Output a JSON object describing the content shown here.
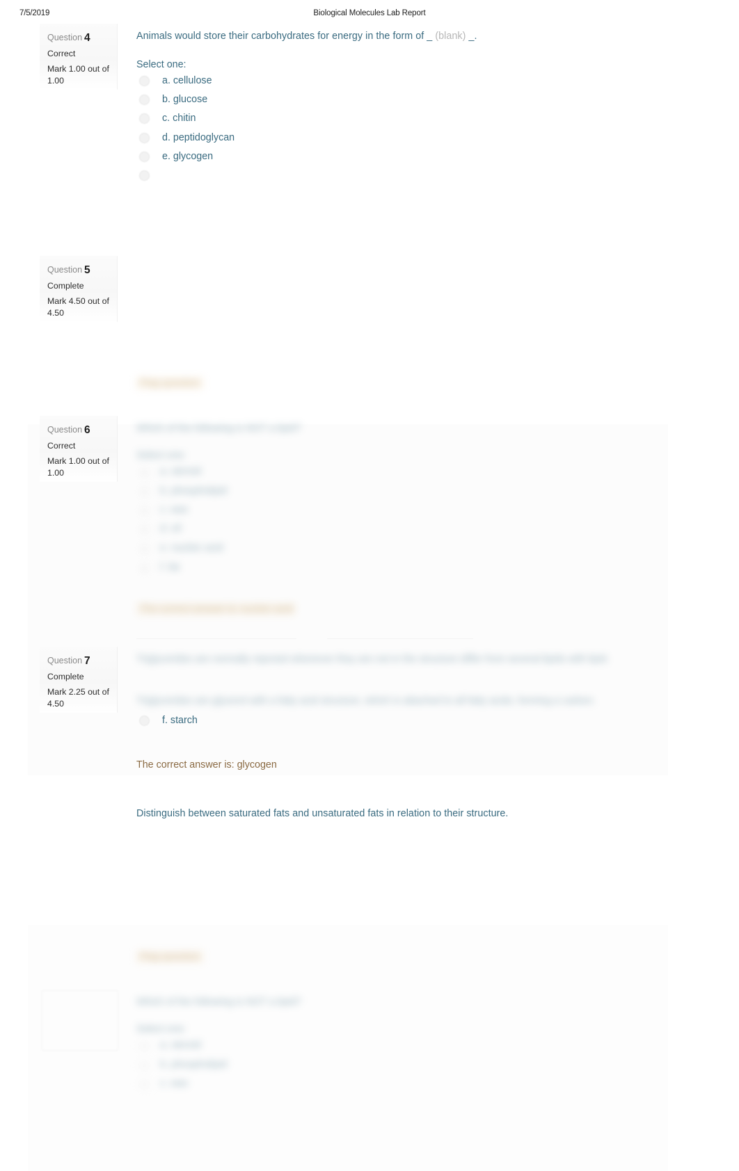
{
  "document": {
    "date": "7/5/2019",
    "title": "Biological Molecules Lab Report"
  },
  "colors": {
    "question_text": "#3a6b80",
    "feedback_text": "#8a6a43",
    "info_number": "#8a8a8a",
    "info_body": "#2b2b2b",
    "blank_placeholder": "#b6b6b6"
  },
  "questions": [
    {
      "number_label": "Question",
      "number": "4",
      "state": "Correct",
      "grade": "Mark 1.00 out of 1.00",
      "text_before_blank": "Animals would store their carbohydrates for energy in the form of _",
      "blank_placeholder": "(blank)",
      "text_after_blank": "_.",
      "select_prompt": "Select one:",
      "options": [
        {
          "key": "a",
          "label": "a. cellulose"
        },
        {
          "key": "b",
          "label": "b. glucose"
        },
        {
          "key": "c",
          "label": "c. chitin"
        },
        {
          "key": "d",
          "label": "d. peptidoglycan"
        },
        {
          "key": "e",
          "label": "e. glycogen"
        }
      ]
    },
    {
      "number_label": "Question",
      "number": "5",
      "state": "Complete",
      "grade": "Mark 4.50 out of 4.50"
    },
    {
      "number_label": "Question",
      "number": "6",
      "state": "Correct",
      "grade": "Mark 1.00 out of 1.00"
    },
    {
      "number_label": "Question",
      "number": "7",
      "state": "Complete",
      "grade": "Mark 2.25 out of 4.50"
    }
  ],
  "visible_answer_option": {
    "key": "f",
    "label": "f. starch"
  },
  "feedback": {
    "correct_answer_line": "The correct answer is: glycogen"
  },
  "essay_prompt": {
    "text": "Distinguish between saturated fats and unsaturated fats in relation to their structure."
  },
  "redacted": {
    "note": "illegible-blurred-content",
    "blocks": [
      {
        "id": "flag-badge-1",
        "kind": "badge"
      },
      {
        "id": "question-stem-1",
        "kind": "question-text"
      },
      {
        "id": "select-prompt-1",
        "kind": "prompt"
      },
      {
        "id": "option-rows-1",
        "kind": "options",
        "count": 6
      },
      {
        "id": "feedback-1",
        "kind": "feedback"
      },
      {
        "id": "essay-body-1",
        "kind": "paragraph"
      },
      {
        "id": "essay-body-2",
        "kind": "paragraph"
      },
      {
        "id": "flag-badge-2",
        "kind": "badge"
      },
      {
        "id": "question-stem-2",
        "kind": "question-text"
      },
      {
        "id": "select-prompt-2",
        "kind": "prompt"
      },
      {
        "id": "option-rows-2",
        "kind": "options",
        "count": 3
      }
    ]
  }
}
